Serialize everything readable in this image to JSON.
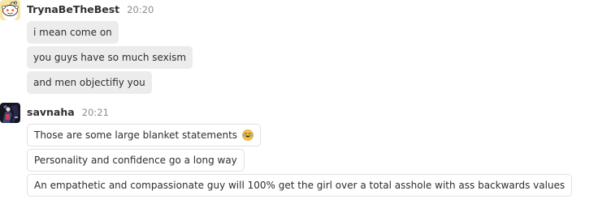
{
  "messages": [
    {
      "user": "TrynaBeTheBest",
      "time": "20:20",
      "avatar_icon": "reddit-snoo-avatar-icon",
      "lines": [
        "i mean come on",
        "you guys have so much sexism",
        "and men objectifiy you"
      ]
    },
    {
      "user": "savnaha",
      "time": "20:21",
      "avatar_icon": "anime-character-avatar-icon",
      "lines": [
        "Those are some large blanket statements",
        "Personality and confidence go a long way",
        "An empathetic and compassionate guy will 100% get the girl over a total asshole with ass backwards values"
      ],
      "emoji_after_first_line": "laughing-tears-emoji-icon"
    }
  ]
}
